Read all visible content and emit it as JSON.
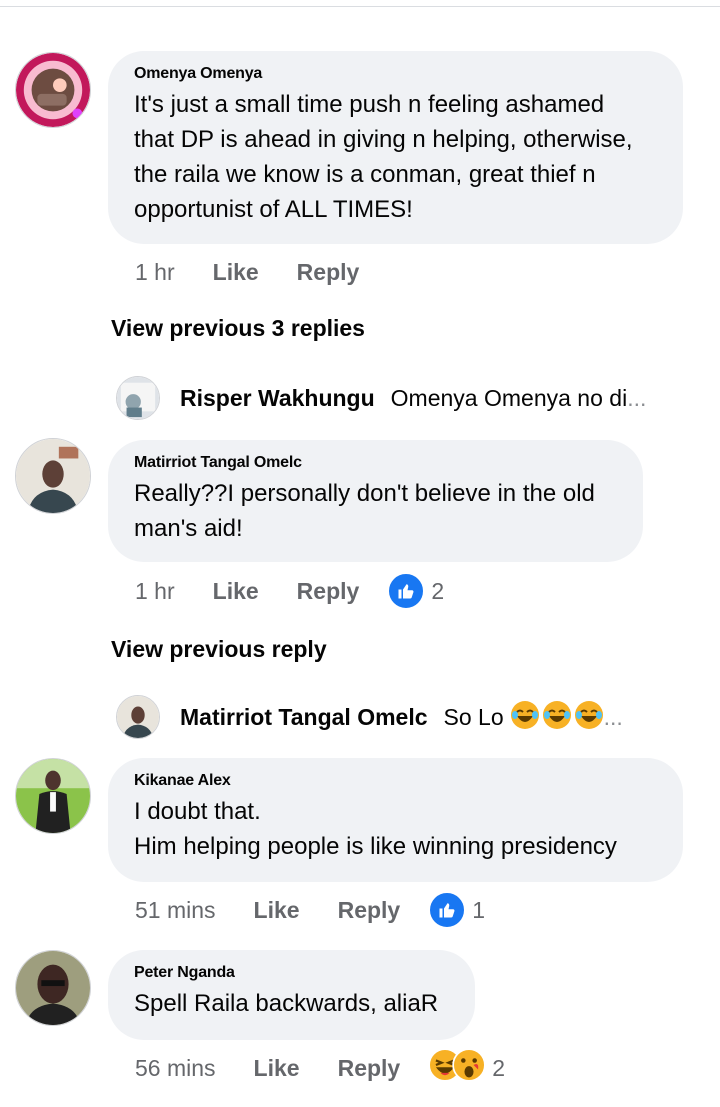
{
  "comments": [
    {
      "author": "Omenya Omenya",
      "text": "It's just a small time push n feeling ashamed\nthat DP is ahead in giving n helping, otherwise,\nthe raila we know is a conman, great thief n\nopportunist of ALL TIMES!",
      "time": "1 hr",
      "like": "Like",
      "reply": "Reply"
    },
    {
      "author": "Matirriot Tangal Omelc",
      "text": "Really??I personally don't believe in the old\nman's aid!",
      "time": "1 hr",
      "like": "Like",
      "reply": "Reply",
      "reaction_count": "2",
      "reaction_icon": "like-icon"
    },
    {
      "author": "Kikanae Alex",
      "text": "I doubt that.\nHim helping people is like winning presidency",
      "time": "51 mins",
      "like": "Like",
      "reply": "Reply",
      "reaction_count": "1",
      "reaction_icon": "like-icon"
    },
    {
      "author": "Peter Nganda",
      "text": "Spell Raila backwards, aliaR",
      "time": "56 mins",
      "like": "Like",
      "reply": "Reply",
      "reaction_count": "2",
      "reaction_icon": "haha-icon"
    }
  ],
  "view_previous": [
    "View previous 3 replies",
    "View previous reply"
  ],
  "reply_previews": [
    {
      "author": "Risper Wakhungu",
      "text": "Omenya Omenya no di",
      "ellipsis": "..."
    },
    {
      "author": "Matirriot Tangal Omelc",
      "text": "So Lo",
      "ellipsis": "..."
    }
  ],
  "colors": {
    "bubble": "#f0f2f5",
    "meta": "#65676b",
    "like_blue": "#1877f2"
  }
}
